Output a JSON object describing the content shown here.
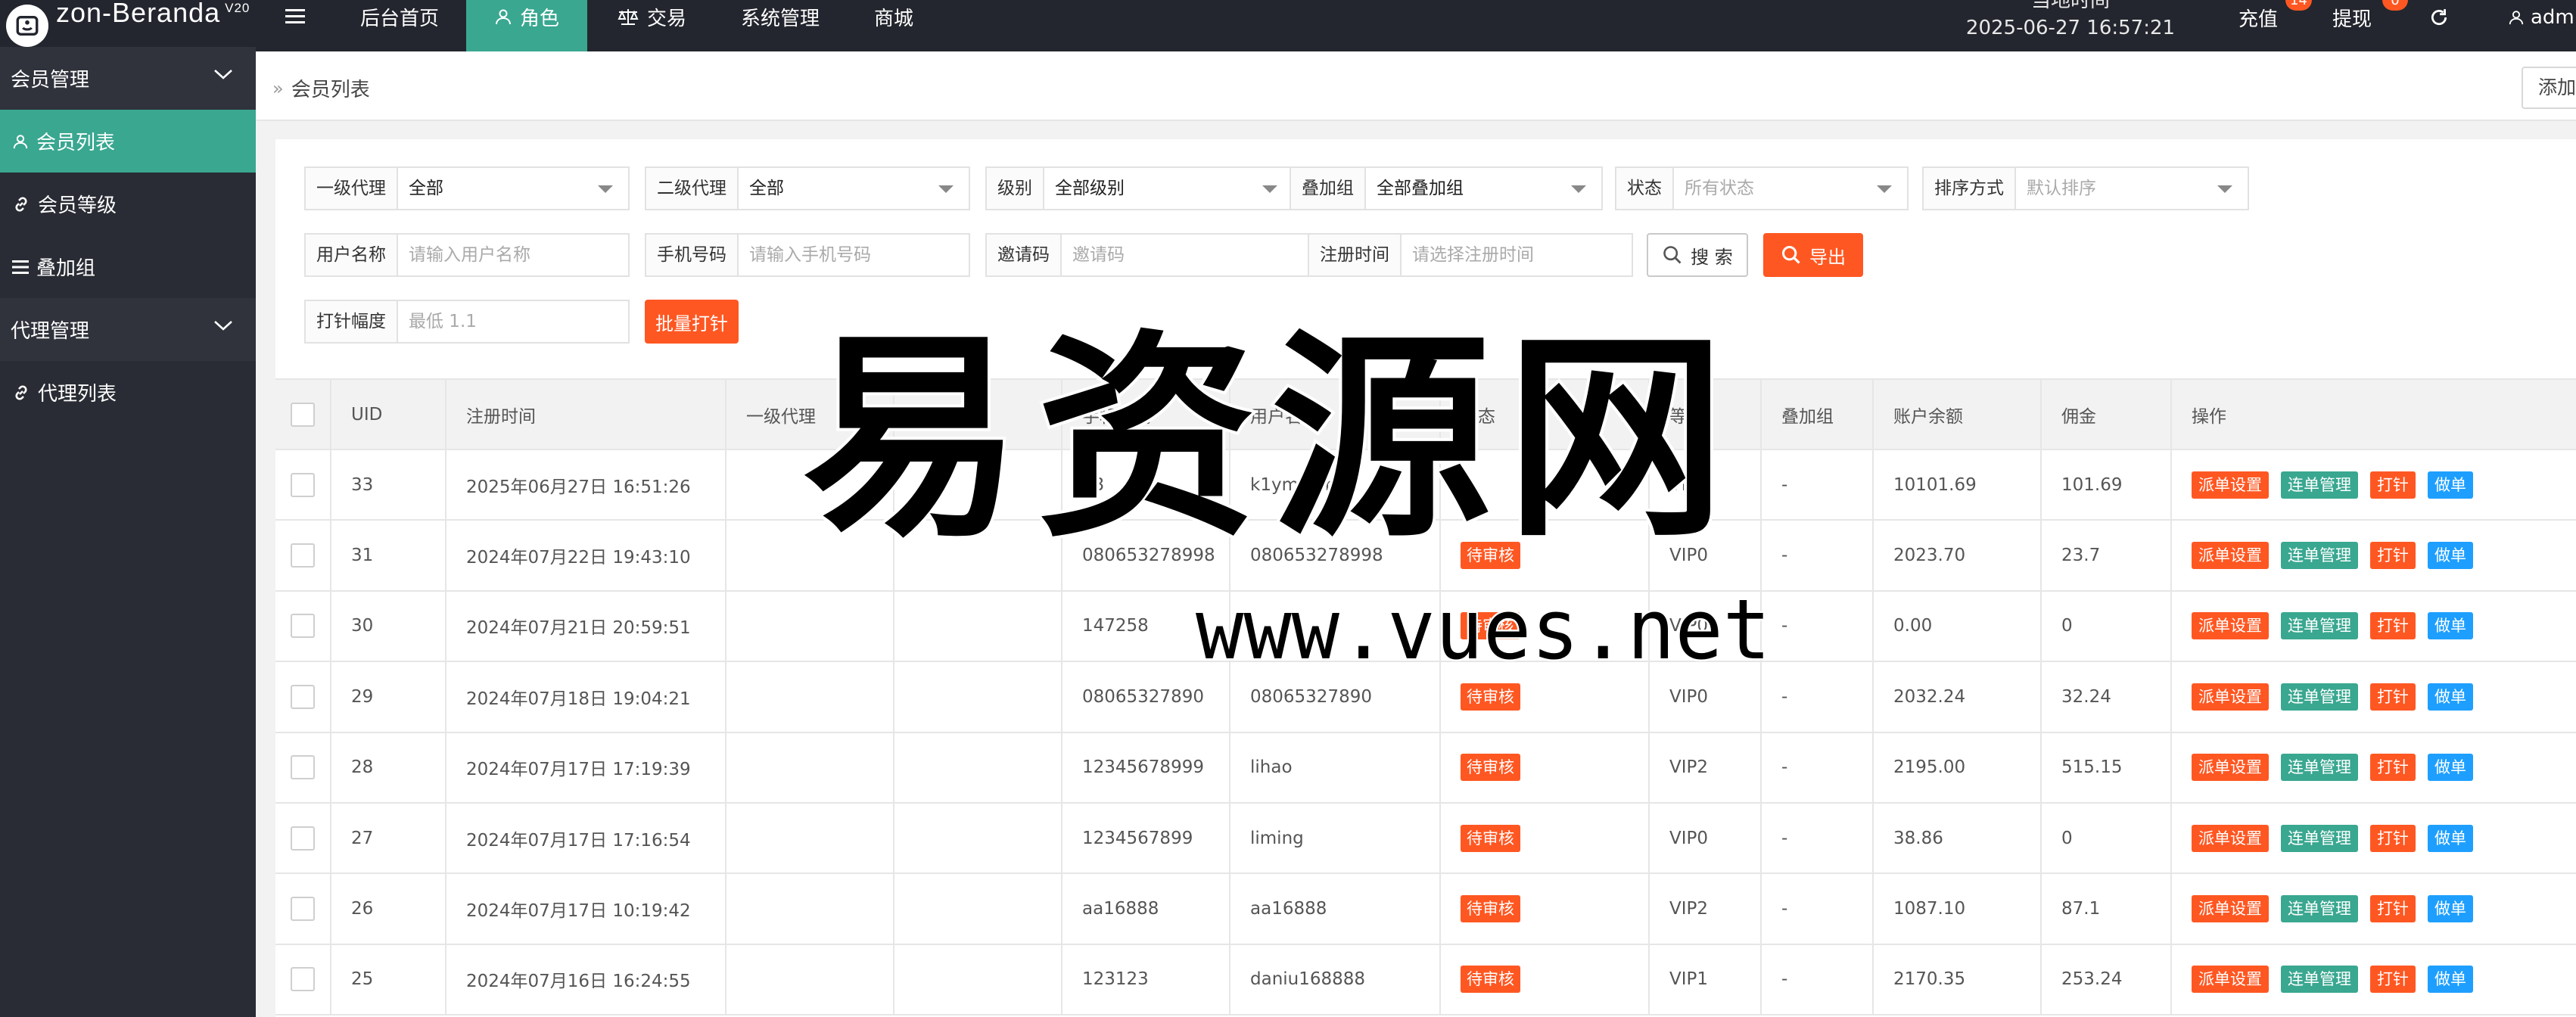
{
  "app": {
    "logo_text": "zon-Beranda",
    "version": "V20"
  },
  "topnav": {
    "items": [
      {
        "label": "后台首页",
        "icon": "none"
      },
      {
        "label": "角色",
        "icon": "user-icon"
      },
      {
        "label": "交易",
        "icon": "scale-icon"
      },
      {
        "label": "系统管理",
        "icon": "none"
      },
      {
        "label": "商城",
        "icon": "none"
      }
    ],
    "clock_label": "当地时间",
    "clock_value": "2025-06-27 16:57:21",
    "recharge_label": "充值",
    "recharge_badge": "14",
    "withdraw_label": "提现",
    "withdraw_badge": "0",
    "user_label": "adm"
  },
  "sidebar": {
    "items": [
      {
        "label": "会员管理",
        "type": "group",
        "icon": "chevron-down-icon"
      },
      {
        "label": "会员列表",
        "type": "item",
        "icon": "user-icon",
        "active": true
      },
      {
        "label": "会员等级",
        "type": "item",
        "icon": "link-icon"
      },
      {
        "label": "叠加组",
        "type": "item",
        "icon": "list-icon"
      },
      {
        "label": "代理管理",
        "type": "group",
        "icon": "chevron-down-icon"
      },
      {
        "label": "代理列表",
        "type": "item",
        "icon": "link-icon"
      }
    ]
  },
  "breadcrumb": {
    "current": "会员列表",
    "add_button": "添加会"
  },
  "filters": {
    "agent1_label": "一级代理",
    "agent1_value": "全部",
    "agent2_label": "二级代理",
    "agent2_value": "全部",
    "level_label": "级别",
    "level_value": "全部级别",
    "group_label": "叠加组",
    "group_value": "全部叠加组",
    "status_label": "状态",
    "status_placeholder": "所有状态",
    "sort_label": "排序方式",
    "sort_placeholder": "默认排序",
    "username_label": "用户名称",
    "username_placeholder": "请输入用户名称",
    "phone_label": "手机号码",
    "phone_placeholder": "请输入手机号码",
    "invite_label": "邀请码",
    "invite_placeholder": "邀请码",
    "regtime_label": "注册时间",
    "regtime_placeholder": "请选择注册时间",
    "search_button": "搜 索",
    "export_button": "导出",
    "hit_label": "打针幅度",
    "hit_placeholder": "最低 1.1",
    "batch_button": "批量打针"
  },
  "table": {
    "headers": [
      "UID",
      "注册时间",
      "一级代理",
      "二级代理",
      "手机号码",
      "用户名",
      "状态",
      "等级",
      "叠加组",
      "账户余额",
      "佣金",
      "操作"
    ],
    "rows": [
      {
        "uid": "33",
        "reg": "2025年06月27日 16:51:26",
        "agent1": "",
        "agent2": "",
        "phone": "13",
        "user": "k1ymcom",
        "status": "",
        "level": "VIP0",
        "group": "-",
        "balance": "10101.69",
        "commission": "101.69"
      },
      {
        "uid": "31",
        "reg": "2024年07月22日 19:43:10",
        "agent1": "",
        "agent2": "",
        "phone": "080653278998",
        "user": "080653278998",
        "status": "待审核",
        "level": "VIP0",
        "group": "-",
        "balance": "2023.70",
        "commission": "23.7"
      },
      {
        "uid": "30",
        "reg": "2024年07月21日 20:59:51",
        "agent1": "",
        "agent2": "",
        "phone": "147258",
        "user": "",
        "status": "待审核",
        "level": "VIP0",
        "group": "-",
        "balance": "0.00",
        "commission": "0"
      },
      {
        "uid": "29",
        "reg": "2024年07月18日 19:04:21",
        "agent1": "",
        "agent2": "",
        "phone": "08065327890",
        "user": "08065327890",
        "status": "待审核",
        "level": "VIP0",
        "group": "-",
        "balance": "2032.24",
        "commission": "32.24"
      },
      {
        "uid": "28",
        "reg": "2024年07月17日 17:19:39",
        "agent1": "",
        "agent2": "",
        "phone": "12345678999",
        "user": "lihao",
        "status": "待审核",
        "level": "VIP2",
        "group": "-",
        "balance": "2195.00",
        "commission": "515.15"
      },
      {
        "uid": "27",
        "reg": "2024年07月17日 17:16:54",
        "agent1": "",
        "agent2": "",
        "phone": "1234567899",
        "user": "liming",
        "status": "待审核",
        "level": "VIP0",
        "group": "-",
        "balance": "38.86",
        "commission": "0"
      },
      {
        "uid": "26",
        "reg": "2024年07月17日 10:19:42",
        "agent1": "",
        "agent2": "",
        "phone": "aa16888",
        "user": "aa16888",
        "status": "待审核",
        "level": "VIP2",
        "group": "-",
        "balance": "1087.10",
        "commission": "87.1"
      },
      {
        "uid": "25",
        "reg": "2024年07月16日 16:24:55",
        "agent1": "",
        "agent2": "",
        "phone": "123123",
        "user": "daniu168888",
        "status": "待审核",
        "level": "VIP1",
        "group": "-",
        "balance": "2170.35",
        "commission": "253.24"
      }
    ],
    "actions": [
      "派单设置",
      "连单管理",
      "打针",
      "做单"
    ]
  },
  "watermark": {
    "title": "易资源网",
    "url": "www.vues.net"
  },
  "colors": {
    "topbar": "#23262e",
    "sidebar": "#292c34",
    "accent": "#3aa790",
    "danger": "#ff5722",
    "info": "#1e9fff"
  }
}
